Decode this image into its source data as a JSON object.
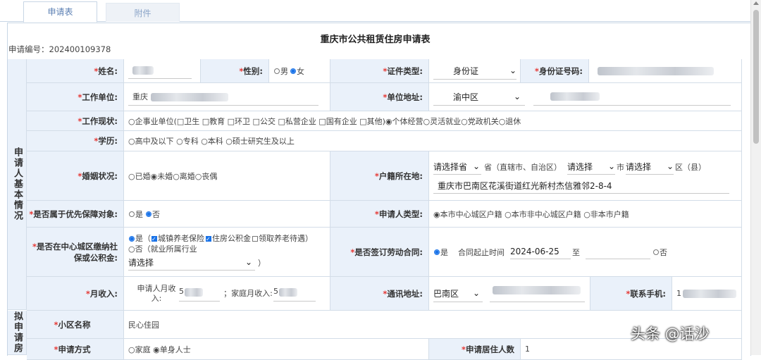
{
  "tabs": {
    "application": "申请表",
    "attachments": "附件"
  },
  "form": {
    "title": "重庆市公共租赁住房申请表",
    "app_no_label": "申请编号：",
    "app_no": "202400109378",
    "section_applicant": "申请人基本情况",
    "section_intended": "拟申请房",
    "name": {
      "label": "姓名:",
      "value": ""
    },
    "gender": {
      "label": "性别:",
      "male": "男",
      "female": "女",
      "selected": "女"
    },
    "id_type": {
      "label": "证件类型:",
      "value": "身份证"
    },
    "id_no": {
      "label": "身份证号码:",
      "value": ""
    },
    "employer": {
      "label": "工作单位:",
      "value": "重庆"
    },
    "employer_address": {
      "label": "单位地址:",
      "district": "渝中区",
      "detail": ""
    },
    "job_status": {
      "label": "工作现状:",
      "text": "○企事业单位(□卫生 □教育 □环卫 □公交 □私营企业 □国有企业 □其他)◉个体经营○灵活就业○党政机关○退休"
    },
    "education": {
      "label": "学历:",
      "text": "○高中及以下 ○专科 ○本科 ○硕士研究生及以上"
    },
    "marital": {
      "label": "婚姻状况:",
      "text": "○已婚◉未婚○离婚○丧偶"
    },
    "hukou": {
      "label": "户籍所在地:",
      "province_sel": "请选择省",
      "province_suffix": "省（直辖市、自治区）",
      "city_sel": "请选择",
      "city_suffix": "市",
      "district_sel": "请选择",
      "district_suffix": "区（县）",
      "address": "重庆市巴南区花溪街道红光新村杰信雅邻2-8-4"
    },
    "priority": {
      "label": "是否属于优先保障对象:",
      "yes": "是",
      "no": "否"
    },
    "applicant_type": {
      "label": "申请人类型:",
      "text": "◉本市中心城区户籍 ○本市非中心城区户籍 ○非本市户籍"
    },
    "social_security": {
      "label": "是否在中心城区缴纳社保或公积金:",
      "yes": "是",
      "opt1": "城镇养老保险",
      "opt2": "住房公积金",
      "opt3": "领取养老待遇",
      "close_paren": "）",
      "open_paren": "（",
      "no_text": "○否（就业所属行业",
      "select": "请选择",
      "select_close": "）"
    },
    "labor_contract": {
      "label": "是否签订劳动合同:",
      "yes": "是",
      "start_label": "合同起止时间",
      "start": "2024-06-25",
      "to": "至",
      "no": "否"
    },
    "income": {
      "label": "月收入:",
      "applicant_label": "申请人月收入:",
      "applicant_value": "5",
      "family_label": "；家庭月收入:",
      "family_value": "5"
    },
    "mail_address": {
      "label": "通讯地址:",
      "district": "巴南区"
    },
    "phone": {
      "label": "联系手机:",
      "value": "1"
    },
    "community": {
      "label": "小区名称",
      "value": "民心佳园"
    },
    "apply_mode": {
      "label": "申请方式",
      "text": "○家庭 ◉单身人士"
    },
    "household": {
      "label": "申请居住人数",
      "value": "1"
    }
  },
  "watermark": "头条 @话沙"
}
